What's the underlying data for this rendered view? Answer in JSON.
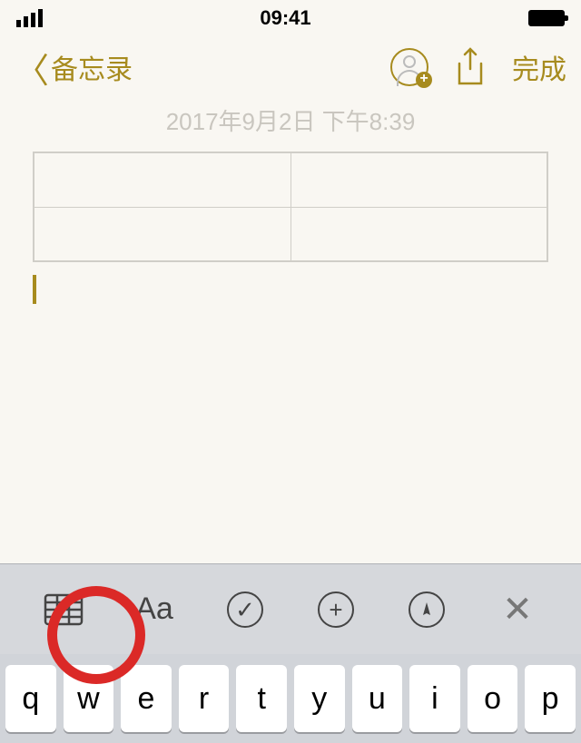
{
  "status_bar": {
    "time": "09:41"
  },
  "nav": {
    "back_label": "备忘录",
    "done_label": "完成",
    "avatar_plus": "+"
  },
  "note": {
    "timestamp": "2017年9月2日 下午8:39"
  },
  "format_bar": {
    "text_style_label": "Aa",
    "check_char": "✓",
    "plus_char": "+",
    "close_char": "✕"
  },
  "keyboard": {
    "row1": [
      "q",
      "w",
      "e",
      "r",
      "t",
      "y",
      "u",
      "i",
      "o",
      "p"
    ]
  }
}
